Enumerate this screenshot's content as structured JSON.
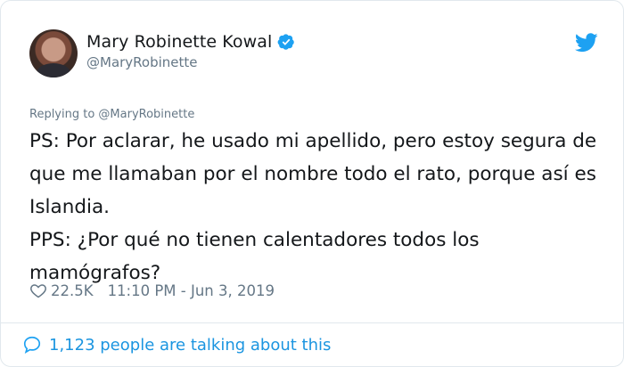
{
  "author": {
    "display_name": "Mary Robinette Kowal",
    "handle": "@MaryRobinette",
    "avatar_icon": "avatar-photo",
    "verified_icon": "verified-badge-icon"
  },
  "tweet": {
    "replying_to": "Replying to @MaryRobinette",
    "lines": [
      "PS: Por aclarar, he usado mi apellido, pero estoy segura de que me llamaban por el nombre todo el rato, porque así es Islandia.",
      "PPS: ¿Por qué no tienen calentadores todos los mamógrafos?"
    ],
    "likes": "22.5K",
    "timestamp": "11:10 PM - Jun 3, 2019"
  },
  "footer": {
    "talking_label": "1,123 people are talking about this"
  },
  "colors": {
    "accent": "#1da1f2",
    "secondary_text": "#657786",
    "border": "#e1e8ed"
  }
}
